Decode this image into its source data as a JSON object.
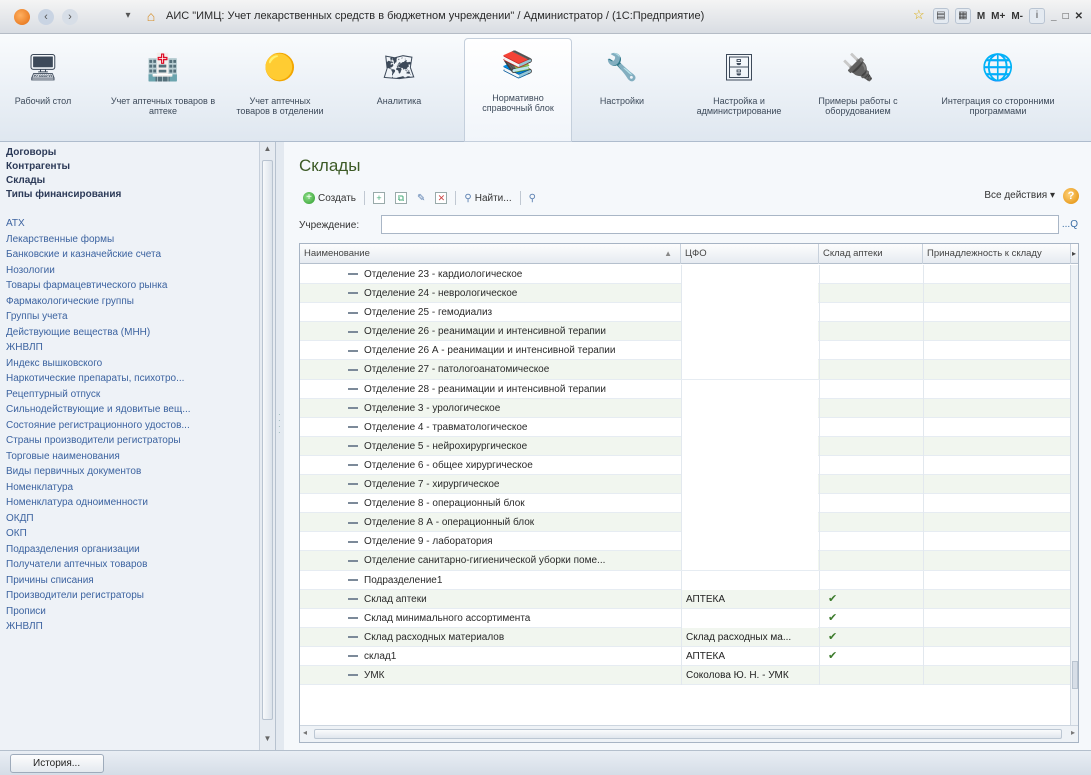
{
  "window": {
    "title": "АИС \"ИМЦ: Учет лекарственных средств в бюджетном учреждении\" / Администратор /  (1С:Предприятие)",
    "menu_arrow": "▾",
    "controls": [
      "☆",
      "▤",
      "▦",
      "M",
      "M+",
      "M-",
      "i",
      "_",
      "□",
      "✕"
    ]
  },
  "sections": [
    {
      "label": "Рабочий стол",
      "icon": "desktop-icon"
    },
    {
      "label": "Учет аптечных товаров в аптеке",
      "icon": "pharmacy-icon"
    },
    {
      "label": "Учет аптечных товаров в отделении",
      "icon": "department-icon"
    },
    {
      "label": "Аналитика",
      "icon": "analytics-icon"
    },
    {
      "label": "Нормативно справочный блок",
      "icon": "books-icon"
    },
    {
      "label": "Настройки",
      "icon": "settings-icon"
    },
    {
      "label": "Настройка и администрирование",
      "icon": "admin-icon"
    },
    {
      "label": "Примеры работы с оборудованием",
      "icon": "equipment-icon"
    },
    {
      "label": "Интеграция со сторонними программами",
      "icon": "globe-icon"
    }
  ],
  "nav": {
    "bold_items": [
      "Договоры",
      "Контрагенты",
      "Склады",
      "Типы финансирования"
    ],
    "items": [
      "АТХ",
      "Лекарственные формы",
      "Банковские и казначейские счета",
      "Нозологии",
      "Товары фармацевтического рынка",
      "Фармакологические группы",
      "Группы учета",
      "Действующие вещества (МНН)",
      "ЖНВЛП",
      "Индекс вышковского",
      "Наркотические препараты, психотро...",
      "Рецептурный отпуск",
      "Сильнодействующие и ядовитые вещ...",
      "Состояние регистрационного удостов...",
      "Страны производители регистраторы",
      "Торговые наименования",
      "Виды первичных документов",
      "Номенклатура",
      "Номенклатура одноименности",
      "ОКДП",
      "ОКП",
      "Подразделения организации",
      "Получатели аптечных товаров",
      "Причины списания",
      "Производители регистраторы",
      "Прописи",
      "ЖНВЛП"
    ]
  },
  "page": {
    "title": "Склады",
    "toolbar": {
      "create": "Создать",
      "find": "Найти...",
      "all_actions": "Все действия ▾",
      "help": "?"
    },
    "filter": {
      "label": "Учреждение:",
      "value": "",
      "buttons": "...Q"
    }
  },
  "table": {
    "columns": [
      "Наименование",
      "ЦФО",
      "Склад аптеки",
      "Принадлежность к складу"
    ],
    "sort_indicator": "▲",
    "rows": [
      {
        "name": "Отделение 23 - кардиологическое",
        "cfo": "",
        "pharmacy": ""
      },
      {
        "name": "Отделение 24 -  неврологическое",
        "cfo": "",
        "pharmacy": ""
      },
      {
        "name": "Отделение 25 - гемодиализ",
        "cfo": "",
        "pharmacy": ""
      },
      {
        "name": "Отделение 26 - реанимации и интенсивной терапии",
        "cfo": "",
        "pharmacy": ""
      },
      {
        "name": "Отделение 26 А - реанимации и интенсивной терапии",
        "cfo": "",
        "pharmacy": ""
      },
      {
        "name": "Отделение 27 - патологоанатомическое",
        "cfo": "",
        "pharmacy": ""
      },
      {
        "name": "Отделение 28 - реанимации и интенсивной терапии",
        "cfo": "",
        "pharmacy": ""
      },
      {
        "name": "Отделение 3 - урологическое",
        "cfo": "",
        "pharmacy": ""
      },
      {
        "name": "Отделение 4 - травматологическое",
        "cfo": "",
        "pharmacy": ""
      },
      {
        "name": "Отделение 5 - нейрохирургическое",
        "cfo": "",
        "pharmacy": ""
      },
      {
        "name": "Отделение 6 -  общее хирургическое",
        "cfo": "",
        "pharmacy": ""
      },
      {
        "name": "Отделение 7 - хирургическое",
        "cfo": "",
        "pharmacy": ""
      },
      {
        "name": "Отделение 8 - операционный блок",
        "cfo": "",
        "pharmacy": ""
      },
      {
        "name": "Отделение 8 А - операционный блок",
        "cfo": "",
        "pharmacy": ""
      },
      {
        "name": "Отделение 9 - лаборатория",
        "cfo": "",
        "pharmacy": ""
      },
      {
        "name": "Отделение санитарно-гигиенической уборки поме...",
        "cfo": "",
        "pharmacy": ""
      },
      {
        "name": "Подразделение1",
        "cfo": "",
        "pharmacy": ""
      },
      {
        "name": "Склад аптеки",
        "cfo": "АПТЕКА",
        "pharmacy": "✔"
      },
      {
        "name": "Склад минимального ассортимента",
        "cfo": "",
        "pharmacy": "✔"
      },
      {
        "name": "Склад расходных материалов",
        "cfo": "Склад расходных ма...",
        "pharmacy": "✔"
      },
      {
        "name": "склад1",
        "cfo": "АПТЕКА",
        "pharmacy": "✔"
      },
      {
        "name": "УМК",
        "cfo": "Соколова Ю. Н. - УМК",
        "pharmacy": ""
      }
    ]
  },
  "statusbar": {
    "history": "История..."
  }
}
